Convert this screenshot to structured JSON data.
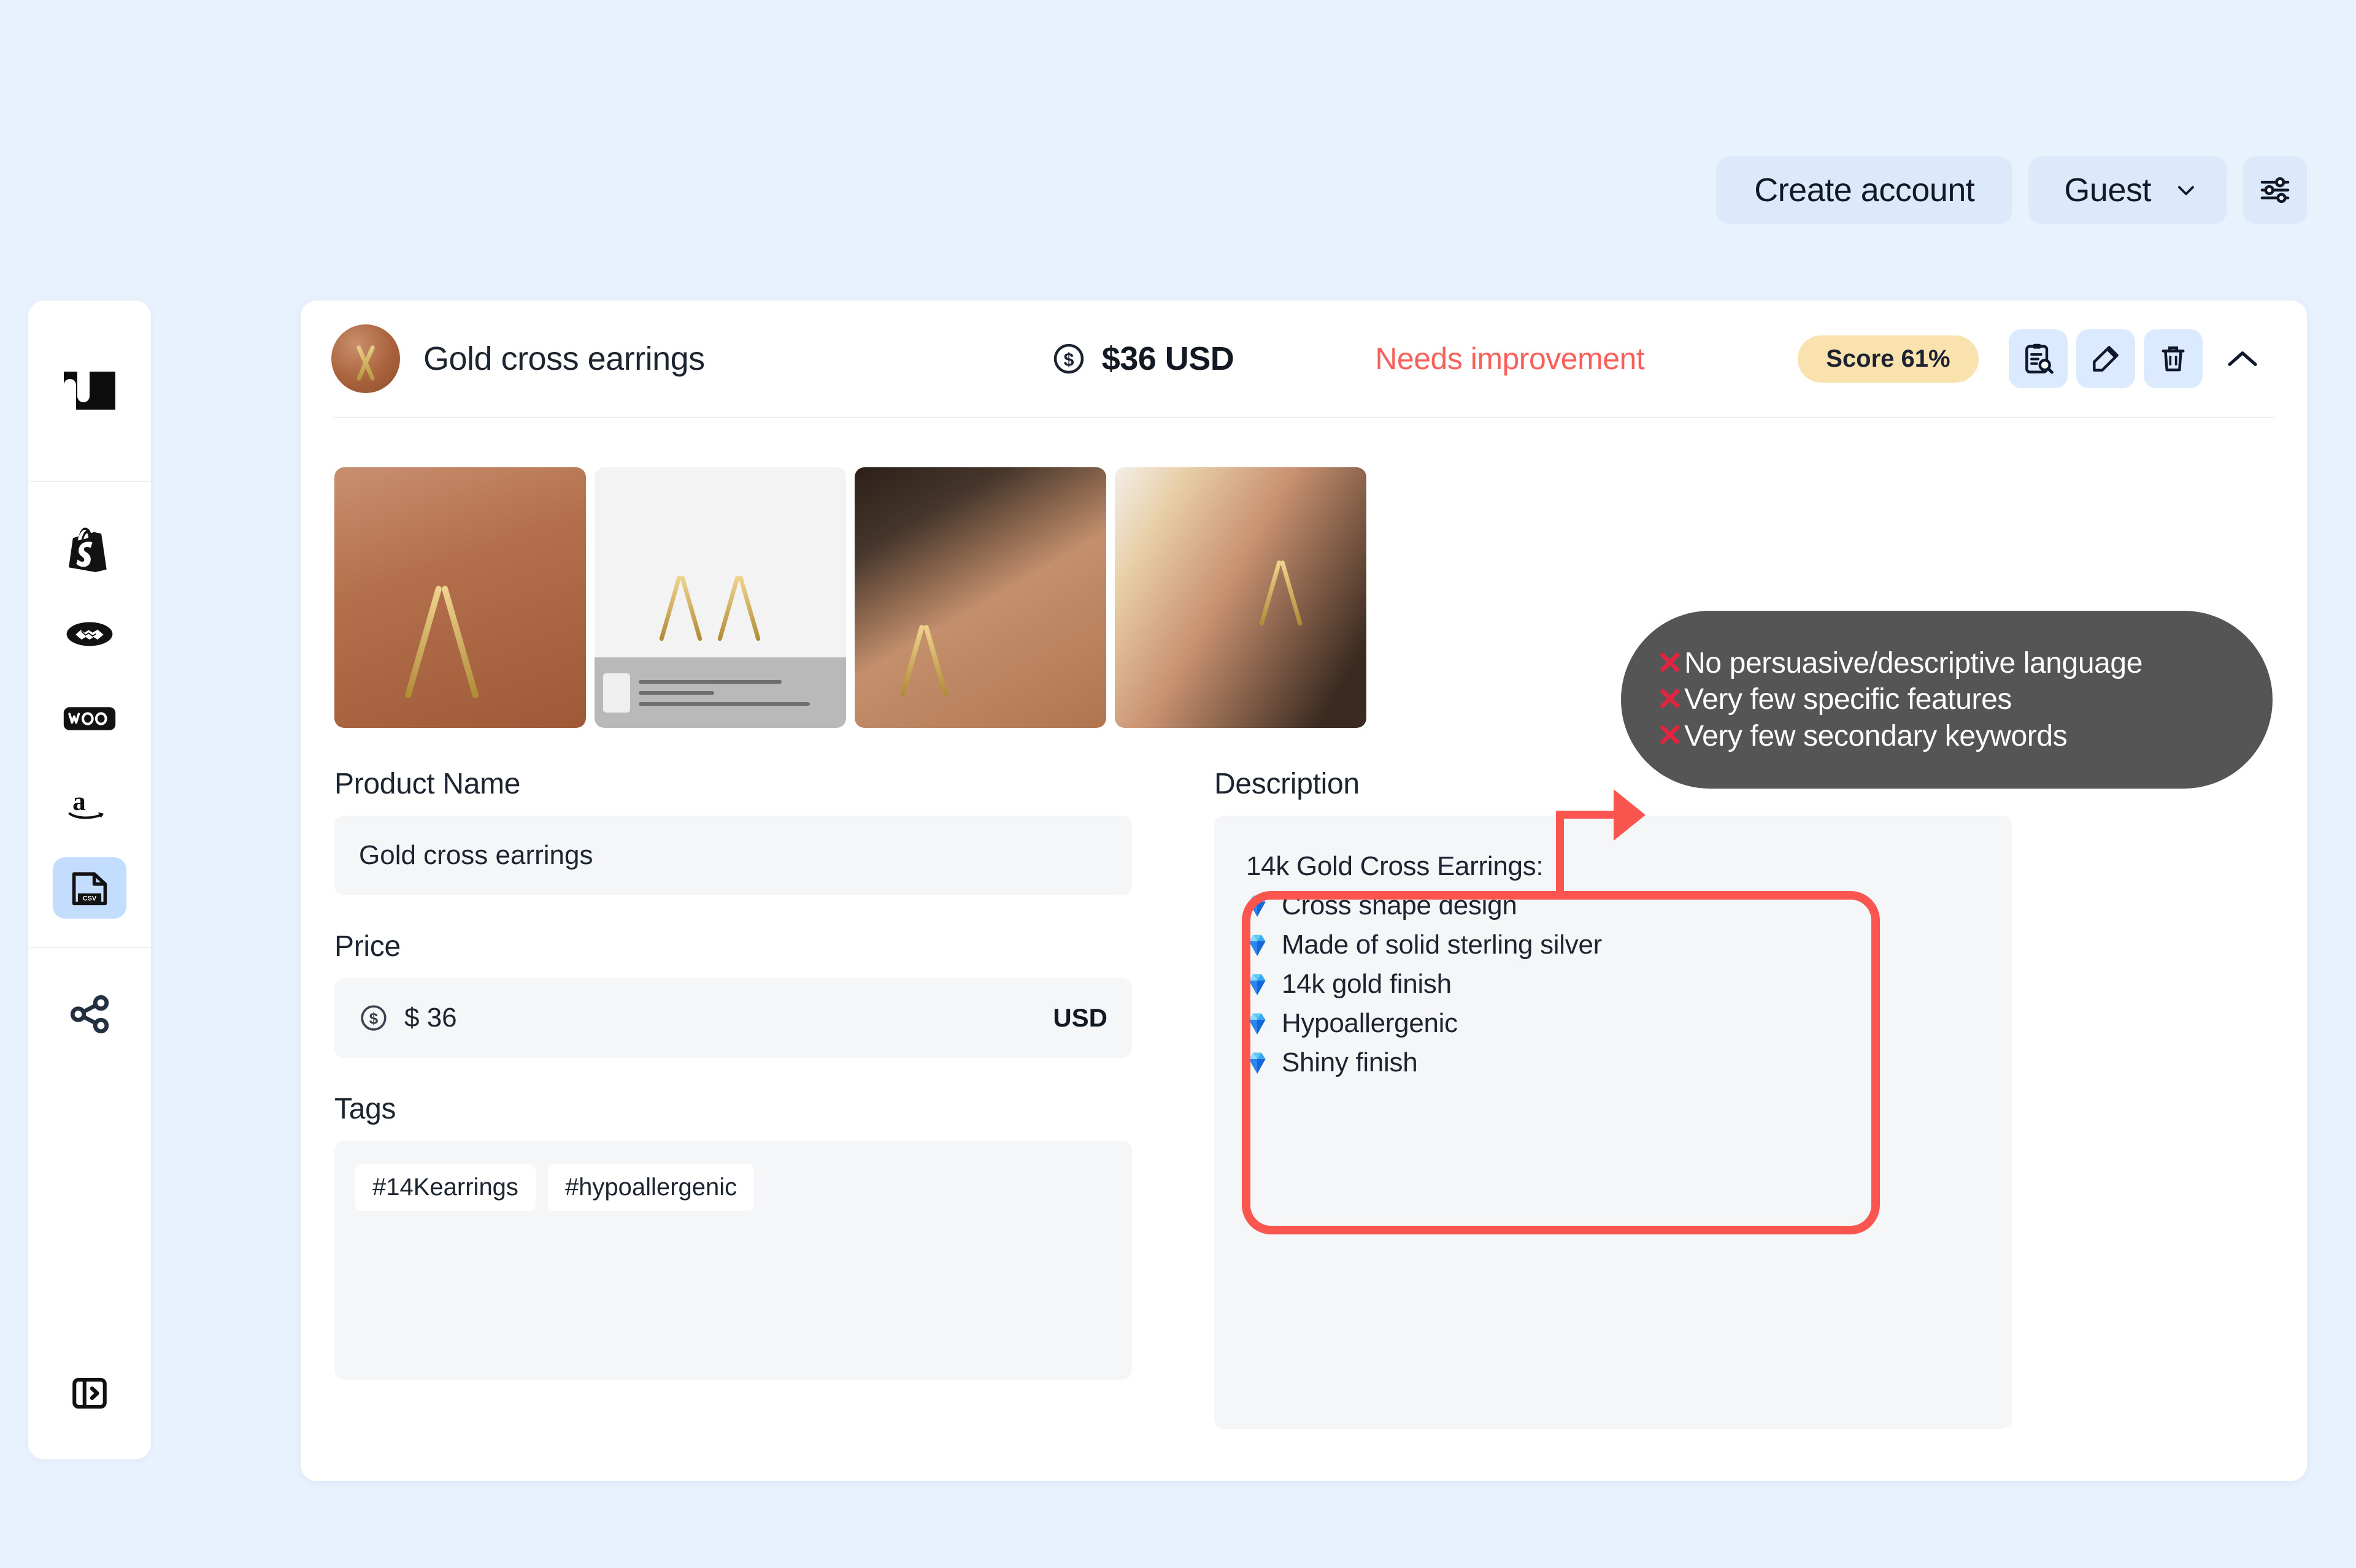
{
  "topbar": {
    "create_account_label": "Create account",
    "guest_label": "Guest",
    "chevron_icon": "chevron-down-icon",
    "settings_icon": "sliders-icon"
  },
  "sidebar": {
    "logo": "nu",
    "items": [
      {
        "name": "shopify",
        "icon": "shopify-icon",
        "active": false
      },
      {
        "name": "etsy",
        "icon": "handshake-icon",
        "active": false
      },
      {
        "name": "woocommerce",
        "icon": "woo-icon",
        "active": false
      },
      {
        "name": "amazon",
        "icon": "amazon-icon",
        "active": false
      },
      {
        "name": "csv",
        "icon": "csv-file-icon",
        "active": true
      }
    ],
    "share": {
      "name": "share",
      "icon": "share-icon"
    },
    "collapse": {
      "name": "expand-panel",
      "icon": "panel-expand-icon"
    }
  },
  "product": {
    "avatar_icon": "product-thumbnail",
    "name": "Gold cross earrings",
    "price_icon": "dollar-circle-icon",
    "price_display": "$36 USD",
    "status": "Needs improvement",
    "status_color": "#f8605c",
    "score_label": "Score 61%",
    "score_color": "#fae2ae",
    "actions": [
      {
        "name": "audit-report",
        "icon": "clipboard-search-icon"
      },
      {
        "name": "edit",
        "icon": "pencil-edit-icon"
      },
      {
        "name": "delete",
        "icon": "trash-icon"
      }
    ],
    "collapse_icon": "chevron-up-icon"
  },
  "gallery": [
    {
      "name": "gallery-image-1",
      "alt": "Gold cross earring on ear closeup"
    },
    {
      "name": "gallery-image-2",
      "alt": "Pair of gold cross earrings on white packaging"
    },
    {
      "name": "gallery-image-3",
      "alt": "Gold cross earring worn on model ear"
    },
    {
      "name": "gallery-image-4",
      "alt": "Model wearing gold cross earring"
    }
  ],
  "form": {
    "product_name": {
      "label": "Product Name",
      "value": "Gold cross earrings"
    },
    "price": {
      "label": "Price",
      "value": "$ 36",
      "currency": "USD",
      "icon": "dollar-circle-icon"
    },
    "tags": {
      "label": "Tags",
      "values": [
        "#14Kearrings",
        "#hypoallergenic"
      ]
    },
    "description": {
      "label": "Description",
      "title": "14k Gold Cross Earrings:",
      "bullet_icon": "gem-icon",
      "items": [
        "Cross shape design",
        "Made of solid sterling silver",
        "14k gold finish",
        "Hypoallergenic",
        "Shiny finish"
      ]
    }
  },
  "annotation": {
    "accent_color": "#fb5550",
    "tooltip_bg": "#555555",
    "x_mark": "✕",
    "x_color": "#e32440",
    "lines": [
      "No persuasive/descriptive language",
      "Very few specific features",
      "Very few secondary keywords"
    ]
  }
}
